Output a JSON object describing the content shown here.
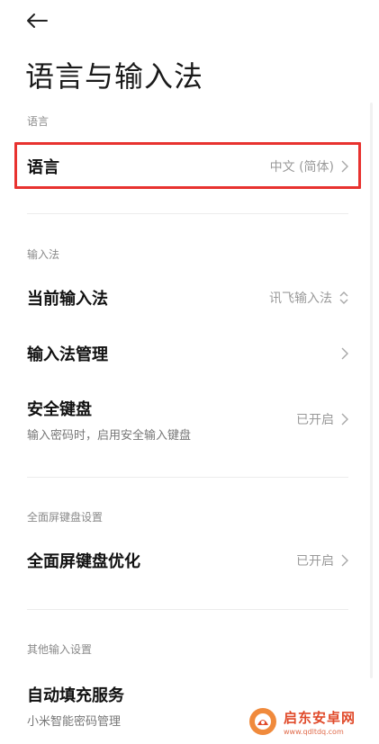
{
  "header": {
    "title": "语言与输入法"
  },
  "sections": {
    "language": {
      "label": "语言",
      "row": {
        "title": "语言",
        "value": "中文 (简体)"
      }
    },
    "input_method": {
      "label": "输入法",
      "current": {
        "title": "当前输入法",
        "value": "讯飞输入法"
      },
      "management": {
        "title": "输入法管理"
      },
      "secure_keyboard": {
        "title": "安全键盘",
        "subtitle": "输入密码时，启用安全输入键盘",
        "value": "已开启"
      }
    },
    "fullscreen": {
      "label": "全面屏键盘设置",
      "optimization": {
        "title": "全面屏键盘优化",
        "value": "已开启"
      }
    },
    "other": {
      "label": "其他输入设置",
      "autofill": {
        "title": "自动填充服务",
        "subtitle": "小米智能密码管理"
      }
    }
  },
  "watermark": {
    "name": "启东安卓网",
    "url": "www.qdltdq.com"
  },
  "colors": {
    "highlight": "#e8322f",
    "watermark": "#e04a2a"
  }
}
